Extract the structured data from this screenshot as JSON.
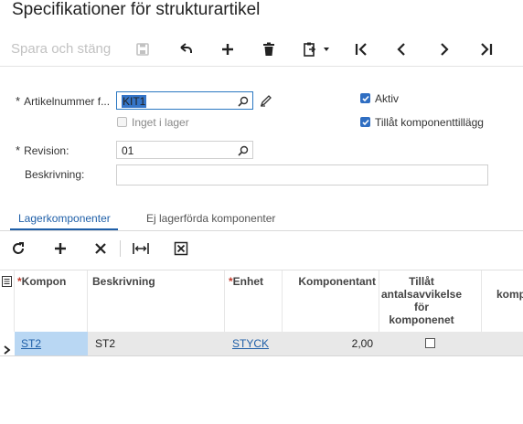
{
  "page_title": "Specifikationer för strukturartikel",
  "toolbar": {
    "save_close_label": "Spara och stäng",
    "icons": [
      "save-icon",
      "undo-icon",
      "add-icon",
      "delete-icon",
      "copy-paste-icon",
      "first-icon",
      "previous-icon",
      "next-icon",
      "last-icon"
    ]
  },
  "form": {
    "item_number_label": "Artikelnummer f...",
    "item_number_value": "KIT1",
    "not_in_stock_label": "Inget i lager",
    "not_in_stock_checked": false,
    "active_label": "Aktiv",
    "active_checked": true,
    "allow_component_addition_label": "Tillåt komponenttillägg",
    "allow_component_addition_checked": true,
    "revision_label": "Revision:",
    "revision_value": "01",
    "description_label": "Beskrivning:",
    "description_value": ""
  },
  "tabs": [
    {
      "label": "Lagerkomponenter",
      "active": true
    },
    {
      "label": "Ej lagerförda komponenter",
      "active": false
    }
  ],
  "grid": {
    "toolbar_icons": [
      "refresh-icon",
      "add-row-icon",
      "delete-row-icon",
      "fit-columns-icon",
      "export-excel-icon"
    ],
    "columns": {
      "component": "Kompon",
      "description": "Beskrivning",
      "unit": "Enhet",
      "component_qty": "Komponentant",
      "allow_qty_variance_1": "Tillåt",
      "allow_qty_variance_2": "antalsavvikelse",
      "allow_qty_variance_3": "för",
      "allow_qty_variance_4": "komponenet",
      "last": "komp"
    },
    "rows": [
      {
        "component": "ST2",
        "description": "ST2",
        "unit": "STYCK",
        "quantity": "2,00",
        "allow_variance": false
      }
    ]
  },
  "colors": {
    "accent": "#1f5fa8",
    "checkbox": "#2f6ec2",
    "selected_row": "#e8e8e8"
  }
}
